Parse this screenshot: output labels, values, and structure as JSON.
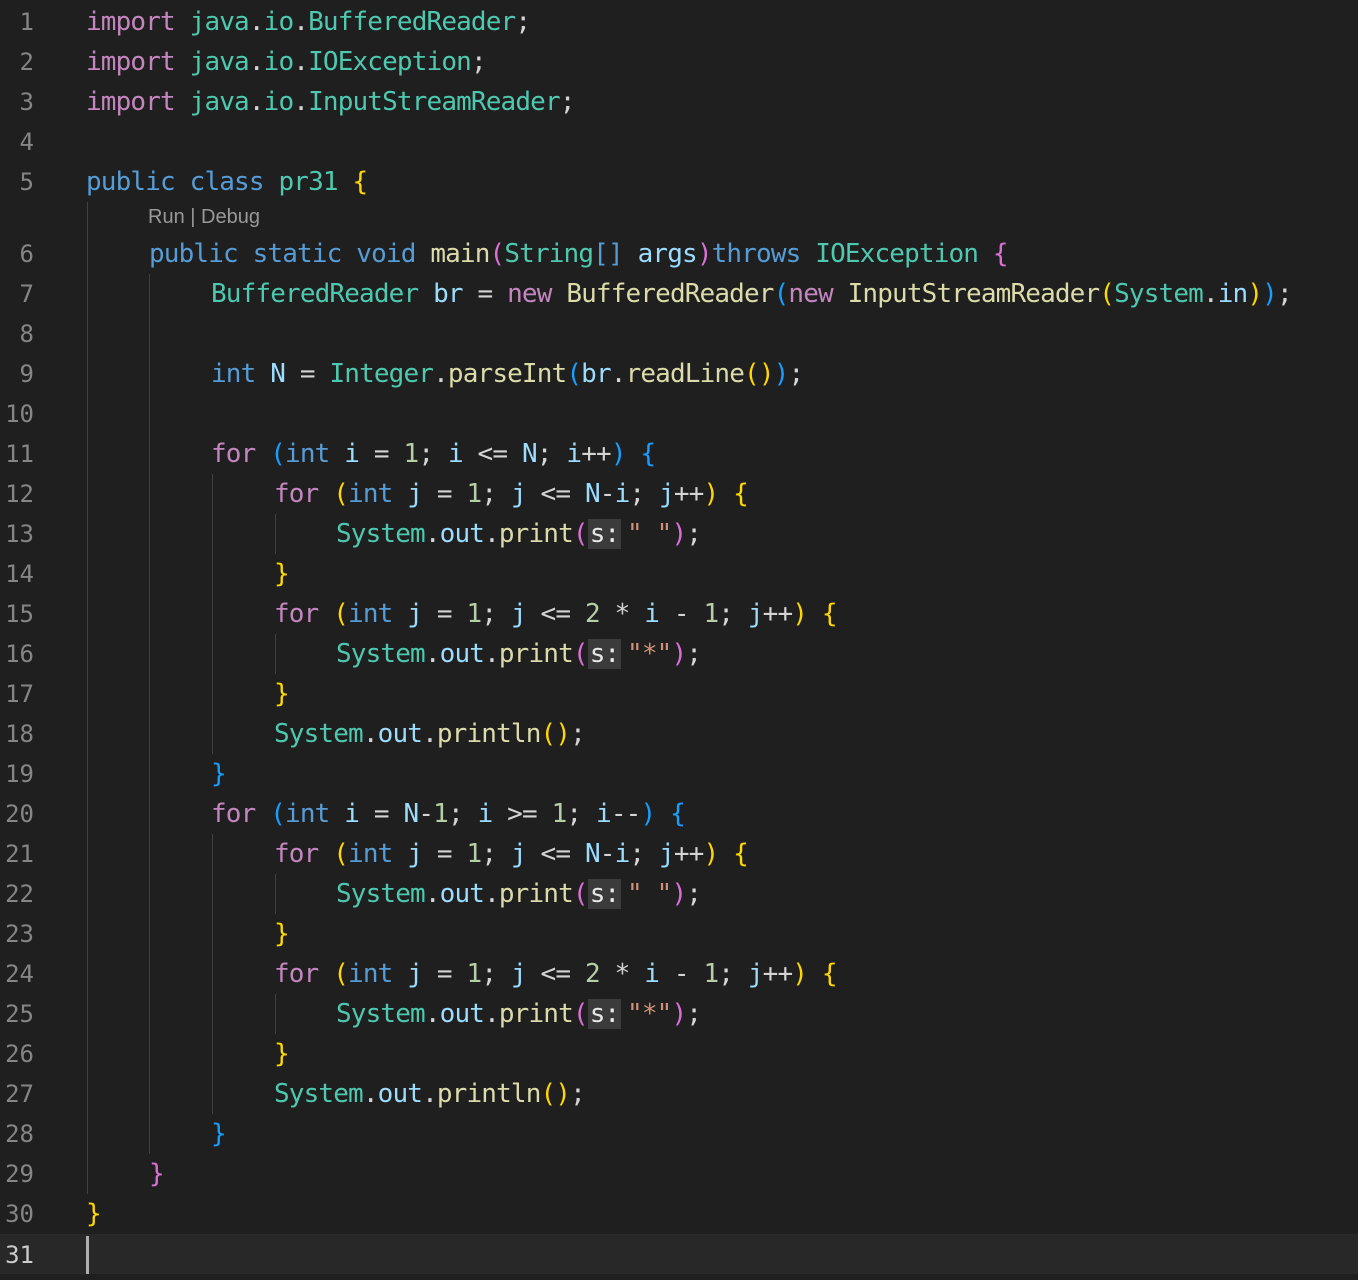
{
  "editor": {
    "language": "java",
    "codelens": {
      "run": "Run",
      "separator": " | ",
      "debug": "Debug"
    },
    "cursor_line": 31,
    "lines": [
      {
        "n": "1",
        "indent": 0,
        "tokens": [
          [
            "import",
            "kwc"
          ],
          [
            " ",
            "pl"
          ],
          [
            "java",
            "ty"
          ],
          [
            ".",
            "pl"
          ],
          [
            "io",
            "ty"
          ],
          [
            ".",
            "pl"
          ],
          [
            "BufferedReader",
            "ty"
          ],
          [
            ";",
            "pl"
          ]
        ]
      },
      {
        "n": "2",
        "indent": 0,
        "tokens": [
          [
            "import",
            "kwc"
          ],
          [
            " ",
            "pl"
          ],
          [
            "java",
            "ty"
          ],
          [
            ".",
            "pl"
          ],
          [
            "io",
            "ty"
          ],
          [
            ".",
            "pl"
          ],
          [
            "IOException",
            "ty"
          ],
          [
            ";",
            "pl"
          ]
        ]
      },
      {
        "n": "3",
        "indent": 0,
        "tokens": [
          [
            "import",
            "kwc"
          ],
          [
            " ",
            "pl"
          ],
          [
            "java",
            "ty"
          ],
          [
            ".",
            "pl"
          ],
          [
            "io",
            "ty"
          ],
          [
            ".",
            "pl"
          ],
          [
            "InputStreamReader",
            "ty"
          ],
          [
            ";",
            "pl"
          ]
        ]
      },
      {
        "n": "4",
        "indent": 0,
        "tokens": []
      },
      {
        "n": "5",
        "indent": 0,
        "tokens": [
          [
            "public",
            "kw"
          ],
          [
            " ",
            "pl"
          ],
          [
            "class",
            "kw"
          ],
          [
            " ",
            "pl"
          ],
          [
            "pr31",
            "ty"
          ],
          [
            " ",
            "pl"
          ],
          [
            "{",
            "b1"
          ]
        ]
      },
      {
        "n": "6",
        "indent": 1,
        "tokens": [
          [
            "public",
            "kw"
          ],
          [
            " ",
            "pl"
          ],
          [
            "static",
            "kw"
          ],
          [
            " ",
            "pl"
          ],
          [
            "void",
            "kw"
          ],
          [
            " ",
            "pl"
          ],
          [
            "main",
            "fn"
          ],
          [
            "(",
            "b2"
          ],
          [
            "String",
            "ty"
          ],
          [
            "[]",
            "kw"
          ],
          [
            " ",
            "pl"
          ],
          [
            "args",
            "var"
          ],
          [
            ")",
            "b2"
          ],
          [
            "throws",
            "kw"
          ],
          [
            " ",
            "pl"
          ],
          [
            "IOException",
            "ty"
          ],
          [
            " ",
            "pl"
          ],
          [
            "{",
            "b2"
          ]
        ]
      },
      {
        "n": "7",
        "indent": 2,
        "tokens": [
          [
            "BufferedReader",
            "ty"
          ],
          [
            " ",
            "pl"
          ],
          [
            "br",
            "var"
          ],
          [
            " = ",
            "pl"
          ],
          [
            "new",
            "kwc"
          ],
          [
            " ",
            "pl"
          ],
          [
            "BufferedReader",
            "fn"
          ],
          [
            "(",
            "b3"
          ],
          [
            "new",
            "kwc"
          ],
          [
            " ",
            "pl"
          ],
          [
            "InputStreamReader",
            "fn"
          ],
          [
            "(",
            "b1"
          ],
          [
            "System",
            "ty"
          ],
          [
            ".",
            "pl"
          ],
          [
            "in",
            "var"
          ],
          [
            ")",
            "b1"
          ],
          [
            ")",
            "b3"
          ],
          [
            ";",
            "pl"
          ]
        ]
      },
      {
        "n": "8",
        "indent": 2,
        "tokens": []
      },
      {
        "n": "9",
        "indent": 2,
        "tokens": [
          [
            "int",
            "kw"
          ],
          [
            " ",
            "pl"
          ],
          [
            "N",
            "var"
          ],
          [
            " = ",
            "pl"
          ],
          [
            "Integer",
            "ty"
          ],
          [
            ".",
            "pl"
          ],
          [
            "parseInt",
            "fn"
          ],
          [
            "(",
            "b3"
          ],
          [
            "br",
            "var"
          ],
          [
            ".",
            "pl"
          ],
          [
            "readLine",
            "fn"
          ],
          [
            "()",
            "b1"
          ],
          [
            ")",
            "b3"
          ],
          [
            ";",
            "pl"
          ]
        ]
      },
      {
        "n": "10",
        "indent": 2,
        "tokens": []
      },
      {
        "n": "11",
        "indent": 2,
        "tokens": [
          [
            "for",
            "kwc"
          ],
          [
            " ",
            "pl"
          ],
          [
            "(",
            "b3"
          ],
          [
            "int",
            "kw"
          ],
          [
            " ",
            "pl"
          ],
          [
            "i",
            "var"
          ],
          [
            " = ",
            "pl"
          ],
          [
            "1",
            "num"
          ],
          [
            "; ",
            "pl"
          ],
          [
            "i",
            "var"
          ],
          [
            " <= ",
            "pl"
          ],
          [
            "N",
            "var"
          ],
          [
            "; ",
            "pl"
          ],
          [
            "i",
            "var"
          ],
          [
            "++",
            "pl"
          ],
          [
            ")",
            "b3"
          ],
          [
            " ",
            "pl"
          ],
          [
            "{",
            "b3"
          ]
        ]
      },
      {
        "n": "12",
        "indent": 3,
        "tokens": [
          [
            "for",
            "kwc"
          ],
          [
            " ",
            "pl"
          ],
          [
            "(",
            "b1"
          ],
          [
            "int",
            "kw"
          ],
          [
            " ",
            "pl"
          ],
          [
            "j",
            "var"
          ],
          [
            " = ",
            "pl"
          ],
          [
            "1",
            "num"
          ],
          [
            "; ",
            "pl"
          ],
          [
            "j",
            "var"
          ],
          [
            " <= ",
            "pl"
          ],
          [
            "N",
            "var"
          ],
          [
            "-",
            "pl"
          ],
          [
            "i",
            "var"
          ],
          [
            "; ",
            "pl"
          ],
          [
            "j",
            "var"
          ],
          [
            "++",
            "pl"
          ],
          [
            ")",
            "b1"
          ],
          [
            " ",
            "pl"
          ],
          [
            "{",
            "b1"
          ]
        ]
      },
      {
        "n": "13",
        "indent": 4,
        "tokens": [
          [
            "System",
            "ty"
          ],
          [
            ".",
            "pl"
          ],
          [
            "out",
            "var"
          ],
          [
            ".",
            "pl"
          ],
          [
            "print",
            "fn"
          ],
          [
            "(",
            "b2"
          ],
          [
            "s:",
            "hint"
          ],
          [
            "\" \"",
            "str"
          ],
          [
            ")",
            "b2"
          ],
          [
            ";",
            "pl"
          ]
        ]
      },
      {
        "n": "14",
        "indent": 3,
        "tokens": [
          [
            "}",
            "b1"
          ]
        ]
      },
      {
        "n": "15",
        "indent": 3,
        "tokens": [
          [
            "for",
            "kwc"
          ],
          [
            " ",
            "pl"
          ],
          [
            "(",
            "b1"
          ],
          [
            "int",
            "kw"
          ],
          [
            " ",
            "pl"
          ],
          [
            "j",
            "var"
          ],
          [
            " = ",
            "pl"
          ],
          [
            "1",
            "num"
          ],
          [
            "; ",
            "pl"
          ],
          [
            "j",
            "var"
          ],
          [
            " <= ",
            "pl"
          ],
          [
            "2",
            "num"
          ],
          [
            " * ",
            "pl"
          ],
          [
            "i",
            "var"
          ],
          [
            " - ",
            "pl"
          ],
          [
            "1",
            "num"
          ],
          [
            "; ",
            "pl"
          ],
          [
            "j",
            "var"
          ],
          [
            "++",
            "pl"
          ],
          [
            ")",
            "b1"
          ],
          [
            " ",
            "pl"
          ],
          [
            "{",
            "b1"
          ]
        ]
      },
      {
        "n": "16",
        "indent": 4,
        "tokens": [
          [
            "System",
            "ty"
          ],
          [
            ".",
            "pl"
          ],
          [
            "out",
            "var"
          ],
          [
            ".",
            "pl"
          ],
          [
            "print",
            "fn"
          ],
          [
            "(",
            "b2"
          ],
          [
            "s:",
            "hint"
          ],
          [
            "\"*\"",
            "str"
          ],
          [
            ")",
            "b2"
          ],
          [
            ";",
            "pl"
          ]
        ]
      },
      {
        "n": "17",
        "indent": 3,
        "tokens": [
          [
            "}",
            "b1"
          ]
        ]
      },
      {
        "n": "18",
        "indent": 3,
        "tokens": [
          [
            "System",
            "ty"
          ],
          [
            ".",
            "pl"
          ],
          [
            "out",
            "var"
          ],
          [
            ".",
            "pl"
          ],
          [
            "println",
            "fn"
          ],
          [
            "()",
            "b1"
          ],
          [
            ";",
            "pl"
          ]
        ]
      },
      {
        "n": "19",
        "indent": 2,
        "tokens": [
          [
            "}",
            "b3"
          ]
        ]
      },
      {
        "n": "20",
        "indent": 2,
        "tokens": [
          [
            "for",
            "kwc"
          ],
          [
            " ",
            "pl"
          ],
          [
            "(",
            "b3"
          ],
          [
            "int",
            "kw"
          ],
          [
            " ",
            "pl"
          ],
          [
            "i",
            "var"
          ],
          [
            " = ",
            "pl"
          ],
          [
            "N",
            "var"
          ],
          [
            "-",
            "pl"
          ],
          [
            "1",
            "num"
          ],
          [
            "; ",
            "pl"
          ],
          [
            "i",
            "var"
          ],
          [
            " >= ",
            "pl"
          ],
          [
            "1",
            "num"
          ],
          [
            "; ",
            "pl"
          ],
          [
            "i",
            "var"
          ],
          [
            "--",
            "pl"
          ],
          [
            ")",
            "b3"
          ],
          [
            " ",
            "pl"
          ],
          [
            "{",
            "b3"
          ]
        ]
      },
      {
        "n": "21",
        "indent": 3,
        "tokens": [
          [
            "for",
            "kwc"
          ],
          [
            " ",
            "pl"
          ],
          [
            "(",
            "b1"
          ],
          [
            "int",
            "kw"
          ],
          [
            " ",
            "pl"
          ],
          [
            "j",
            "var"
          ],
          [
            " = ",
            "pl"
          ],
          [
            "1",
            "num"
          ],
          [
            "; ",
            "pl"
          ],
          [
            "j",
            "var"
          ],
          [
            " <= ",
            "pl"
          ],
          [
            "N",
            "var"
          ],
          [
            "-",
            "pl"
          ],
          [
            "i",
            "var"
          ],
          [
            "; ",
            "pl"
          ],
          [
            "j",
            "var"
          ],
          [
            "++",
            "pl"
          ],
          [
            ")",
            "b1"
          ],
          [
            " ",
            "pl"
          ],
          [
            "{",
            "b1"
          ]
        ]
      },
      {
        "n": "22",
        "indent": 4,
        "tokens": [
          [
            "System",
            "ty"
          ],
          [
            ".",
            "pl"
          ],
          [
            "out",
            "var"
          ],
          [
            ".",
            "pl"
          ],
          [
            "print",
            "fn"
          ],
          [
            "(",
            "b2"
          ],
          [
            "s:",
            "hint"
          ],
          [
            "\" \"",
            "str"
          ],
          [
            ")",
            "b2"
          ],
          [
            ";",
            "pl"
          ]
        ]
      },
      {
        "n": "23",
        "indent": 3,
        "tokens": [
          [
            "}",
            "b1"
          ]
        ]
      },
      {
        "n": "24",
        "indent": 3,
        "tokens": [
          [
            "for",
            "kwc"
          ],
          [
            " ",
            "pl"
          ],
          [
            "(",
            "b1"
          ],
          [
            "int",
            "kw"
          ],
          [
            " ",
            "pl"
          ],
          [
            "j",
            "var"
          ],
          [
            " = ",
            "pl"
          ],
          [
            "1",
            "num"
          ],
          [
            "; ",
            "pl"
          ],
          [
            "j",
            "var"
          ],
          [
            " <= ",
            "pl"
          ],
          [
            "2",
            "num"
          ],
          [
            " * ",
            "pl"
          ],
          [
            "i",
            "var"
          ],
          [
            " - ",
            "pl"
          ],
          [
            "1",
            "num"
          ],
          [
            "; ",
            "pl"
          ],
          [
            "j",
            "var"
          ],
          [
            "++",
            "pl"
          ],
          [
            ")",
            "b1"
          ],
          [
            " ",
            "pl"
          ],
          [
            "{",
            "b1"
          ]
        ]
      },
      {
        "n": "25",
        "indent": 4,
        "tokens": [
          [
            "System",
            "ty"
          ],
          [
            ".",
            "pl"
          ],
          [
            "out",
            "var"
          ],
          [
            ".",
            "pl"
          ],
          [
            "print",
            "fn"
          ],
          [
            "(",
            "b2"
          ],
          [
            "s:",
            "hint"
          ],
          [
            "\"*\"",
            "str"
          ],
          [
            ")",
            "b2"
          ],
          [
            ";",
            "pl"
          ]
        ]
      },
      {
        "n": "26",
        "indent": 3,
        "tokens": [
          [
            "}",
            "b1"
          ]
        ]
      },
      {
        "n": "27",
        "indent": 3,
        "tokens": [
          [
            "System",
            "ty"
          ],
          [
            ".",
            "pl"
          ],
          [
            "out",
            "var"
          ],
          [
            ".",
            "pl"
          ],
          [
            "println",
            "fn"
          ],
          [
            "()",
            "b1"
          ],
          [
            ";",
            "pl"
          ]
        ]
      },
      {
        "n": "28",
        "indent": 2,
        "tokens": [
          [
            "}",
            "b3"
          ]
        ]
      },
      {
        "n": "29",
        "indent": 1,
        "tokens": [
          [
            "}",
            "b2"
          ]
        ]
      },
      {
        "n": "30",
        "indent": 0,
        "tokens": [
          [
            "}",
            "b1"
          ]
        ]
      },
      {
        "n": "31",
        "indent": 0,
        "tokens": []
      }
    ]
  },
  "colors": {
    "background": "#1f1f1f",
    "keyword": "#569cd6",
    "control_keyword": "#c586c0",
    "type": "#4ec9b0",
    "function": "#dcdcaa",
    "variable": "#9cdcfe",
    "number": "#b5cea8",
    "string": "#ce9178",
    "bracket_1": "#ffd700",
    "bracket_2": "#da70d6",
    "bracket_3": "#179fff"
  }
}
